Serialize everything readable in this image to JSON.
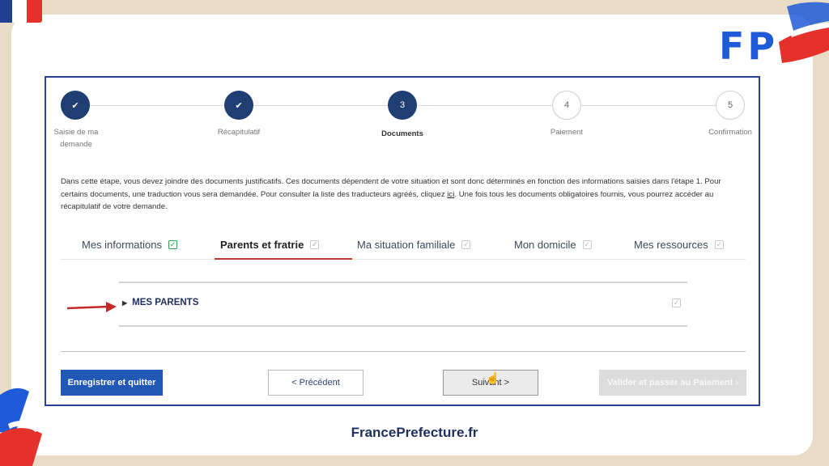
{
  "brand": {
    "logo_text": "FP",
    "footer_text": "FrancePrefecture.fr",
    "colors": {
      "blue": "#1f5bd8",
      "red": "#e4312b",
      "navy": "#1f3f73",
      "accent_red": "#c0392b"
    }
  },
  "stepper": {
    "steps": [
      {
        "number": "",
        "icon": "check-icon",
        "label_line1": "Saisie de ma",
        "label_line2": "demande",
        "state": "done"
      },
      {
        "number": "",
        "icon": "check-icon",
        "label_line1": "Récapitulatif",
        "label_line2": "",
        "state": "done"
      },
      {
        "number": "3",
        "label_line1": "Documents",
        "label_line2": "",
        "state": "current"
      },
      {
        "number": "4",
        "label_line1": "Paiement",
        "label_line2": "",
        "state": "todo"
      },
      {
        "number": "5",
        "label_line1": "Confirmation",
        "label_line2": "",
        "state": "todo"
      }
    ]
  },
  "intro": {
    "part1": "Dans cette étape, vous devez joindre des documents justificatifs. Ces documents dépendent de votre situation et sont donc déterminés en fonction des informations saisies dans l'étape 1. Pour certains documents, une traduction vous sera demandée. Pour consulter la liste des traducteurs agréés, cliquez ",
    "link": "ici",
    "part2": ". Une fois tous les documents obligatoires fournis, vous pourrez accéder au récapitulatif de votre demande."
  },
  "tabs": [
    {
      "label": "Mes informations",
      "checked": true
    },
    {
      "label": "Parents et fratrie",
      "checked": false,
      "active": true
    },
    {
      "label": "Ma situation familiale",
      "checked": false
    },
    {
      "label": "Mon domicile",
      "checked": false
    },
    {
      "label": "Mes ressources",
      "checked": false
    }
  ],
  "section": {
    "title": "MES PARENTS",
    "expanded": false
  },
  "buttons": {
    "save_quit": "Enregistrer et quitter",
    "previous": "< Précédent",
    "next": "Suivant >",
    "validate": "Valider et passer au Paiement ›"
  },
  "icons": {
    "check": "check-icon",
    "caret": "caret-right-icon",
    "arrow": "arrow-right-icon",
    "cursor": "hand-cursor-icon"
  }
}
